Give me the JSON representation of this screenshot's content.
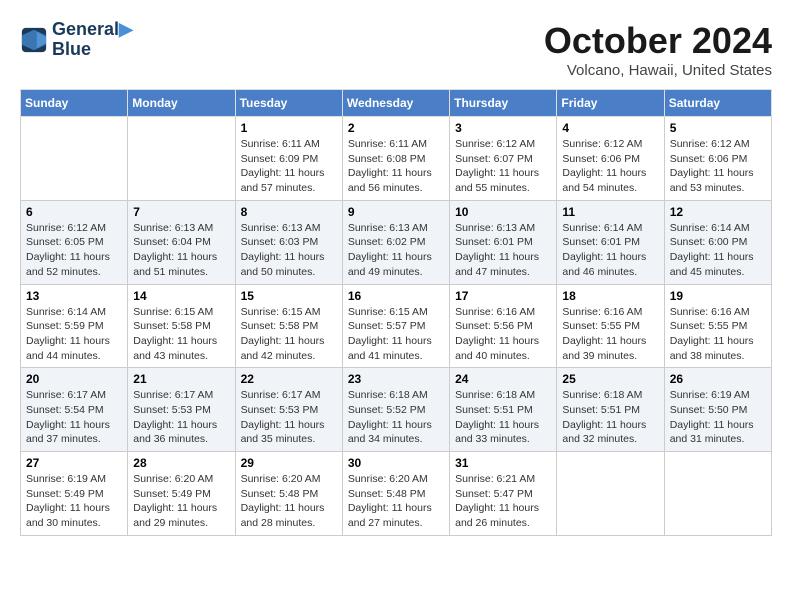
{
  "logo": {
    "line1": "General",
    "line2": "Blue"
  },
  "title": "October 2024",
  "location": "Volcano, Hawaii, United States",
  "weekdays": [
    "Sunday",
    "Monday",
    "Tuesday",
    "Wednesday",
    "Thursday",
    "Friday",
    "Saturday"
  ],
  "weeks": [
    [
      {
        "day": "",
        "sunrise": "",
        "sunset": "",
        "daylight": ""
      },
      {
        "day": "",
        "sunrise": "",
        "sunset": "",
        "daylight": ""
      },
      {
        "day": "1",
        "sunrise": "Sunrise: 6:11 AM",
        "sunset": "Sunset: 6:09 PM",
        "daylight": "Daylight: 11 hours and 57 minutes."
      },
      {
        "day": "2",
        "sunrise": "Sunrise: 6:11 AM",
        "sunset": "Sunset: 6:08 PM",
        "daylight": "Daylight: 11 hours and 56 minutes."
      },
      {
        "day": "3",
        "sunrise": "Sunrise: 6:12 AM",
        "sunset": "Sunset: 6:07 PM",
        "daylight": "Daylight: 11 hours and 55 minutes."
      },
      {
        "day": "4",
        "sunrise": "Sunrise: 6:12 AM",
        "sunset": "Sunset: 6:06 PM",
        "daylight": "Daylight: 11 hours and 54 minutes."
      },
      {
        "day": "5",
        "sunrise": "Sunrise: 6:12 AM",
        "sunset": "Sunset: 6:06 PM",
        "daylight": "Daylight: 11 hours and 53 minutes."
      }
    ],
    [
      {
        "day": "6",
        "sunrise": "Sunrise: 6:12 AM",
        "sunset": "Sunset: 6:05 PM",
        "daylight": "Daylight: 11 hours and 52 minutes."
      },
      {
        "day": "7",
        "sunrise": "Sunrise: 6:13 AM",
        "sunset": "Sunset: 6:04 PM",
        "daylight": "Daylight: 11 hours and 51 minutes."
      },
      {
        "day": "8",
        "sunrise": "Sunrise: 6:13 AM",
        "sunset": "Sunset: 6:03 PM",
        "daylight": "Daylight: 11 hours and 50 minutes."
      },
      {
        "day": "9",
        "sunrise": "Sunrise: 6:13 AM",
        "sunset": "Sunset: 6:02 PM",
        "daylight": "Daylight: 11 hours and 49 minutes."
      },
      {
        "day": "10",
        "sunrise": "Sunrise: 6:13 AM",
        "sunset": "Sunset: 6:01 PM",
        "daylight": "Daylight: 11 hours and 47 minutes."
      },
      {
        "day": "11",
        "sunrise": "Sunrise: 6:14 AM",
        "sunset": "Sunset: 6:01 PM",
        "daylight": "Daylight: 11 hours and 46 minutes."
      },
      {
        "day": "12",
        "sunrise": "Sunrise: 6:14 AM",
        "sunset": "Sunset: 6:00 PM",
        "daylight": "Daylight: 11 hours and 45 minutes."
      }
    ],
    [
      {
        "day": "13",
        "sunrise": "Sunrise: 6:14 AM",
        "sunset": "Sunset: 5:59 PM",
        "daylight": "Daylight: 11 hours and 44 minutes."
      },
      {
        "day": "14",
        "sunrise": "Sunrise: 6:15 AM",
        "sunset": "Sunset: 5:58 PM",
        "daylight": "Daylight: 11 hours and 43 minutes."
      },
      {
        "day": "15",
        "sunrise": "Sunrise: 6:15 AM",
        "sunset": "Sunset: 5:58 PM",
        "daylight": "Daylight: 11 hours and 42 minutes."
      },
      {
        "day": "16",
        "sunrise": "Sunrise: 6:15 AM",
        "sunset": "Sunset: 5:57 PM",
        "daylight": "Daylight: 11 hours and 41 minutes."
      },
      {
        "day": "17",
        "sunrise": "Sunrise: 6:16 AM",
        "sunset": "Sunset: 5:56 PM",
        "daylight": "Daylight: 11 hours and 40 minutes."
      },
      {
        "day": "18",
        "sunrise": "Sunrise: 6:16 AM",
        "sunset": "Sunset: 5:55 PM",
        "daylight": "Daylight: 11 hours and 39 minutes."
      },
      {
        "day": "19",
        "sunrise": "Sunrise: 6:16 AM",
        "sunset": "Sunset: 5:55 PM",
        "daylight": "Daylight: 11 hours and 38 minutes."
      }
    ],
    [
      {
        "day": "20",
        "sunrise": "Sunrise: 6:17 AM",
        "sunset": "Sunset: 5:54 PM",
        "daylight": "Daylight: 11 hours and 37 minutes."
      },
      {
        "day": "21",
        "sunrise": "Sunrise: 6:17 AM",
        "sunset": "Sunset: 5:53 PM",
        "daylight": "Daylight: 11 hours and 36 minutes."
      },
      {
        "day": "22",
        "sunrise": "Sunrise: 6:17 AM",
        "sunset": "Sunset: 5:53 PM",
        "daylight": "Daylight: 11 hours and 35 minutes."
      },
      {
        "day": "23",
        "sunrise": "Sunrise: 6:18 AM",
        "sunset": "Sunset: 5:52 PM",
        "daylight": "Daylight: 11 hours and 34 minutes."
      },
      {
        "day": "24",
        "sunrise": "Sunrise: 6:18 AM",
        "sunset": "Sunset: 5:51 PM",
        "daylight": "Daylight: 11 hours and 33 minutes."
      },
      {
        "day": "25",
        "sunrise": "Sunrise: 6:18 AM",
        "sunset": "Sunset: 5:51 PM",
        "daylight": "Daylight: 11 hours and 32 minutes."
      },
      {
        "day": "26",
        "sunrise": "Sunrise: 6:19 AM",
        "sunset": "Sunset: 5:50 PM",
        "daylight": "Daylight: 11 hours and 31 minutes."
      }
    ],
    [
      {
        "day": "27",
        "sunrise": "Sunrise: 6:19 AM",
        "sunset": "Sunset: 5:49 PM",
        "daylight": "Daylight: 11 hours and 30 minutes."
      },
      {
        "day": "28",
        "sunrise": "Sunrise: 6:20 AM",
        "sunset": "Sunset: 5:49 PM",
        "daylight": "Daylight: 11 hours and 29 minutes."
      },
      {
        "day": "29",
        "sunrise": "Sunrise: 6:20 AM",
        "sunset": "Sunset: 5:48 PM",
        "daylight": "Daylight: 11 hours and 28 minutes."
      },
      {
        "day": "30",
        "sunrise": "Sunrise: 6:20 AM",
        "sunset": "Sunset: 5:48 PM",
        "daylight": "Daylight: 11 hours and 27 minutes."
      },
      {
        "day": "31",
        "sunrise": "Sunrise: 6:21 AM",
        "sunset": "Sunset: 5:47 PM",
        "daylight": "Daylight: 11 hours and 26 minutes."
      },
      {
        "day": "",
        "sunrise": "",
        "sunset": "",
        "daylight": ""
      },
      {
        "day": "",
        "sunrise": "",
        "sunset": "",
        "daylight": ""
      }
    ]
  ]
}
